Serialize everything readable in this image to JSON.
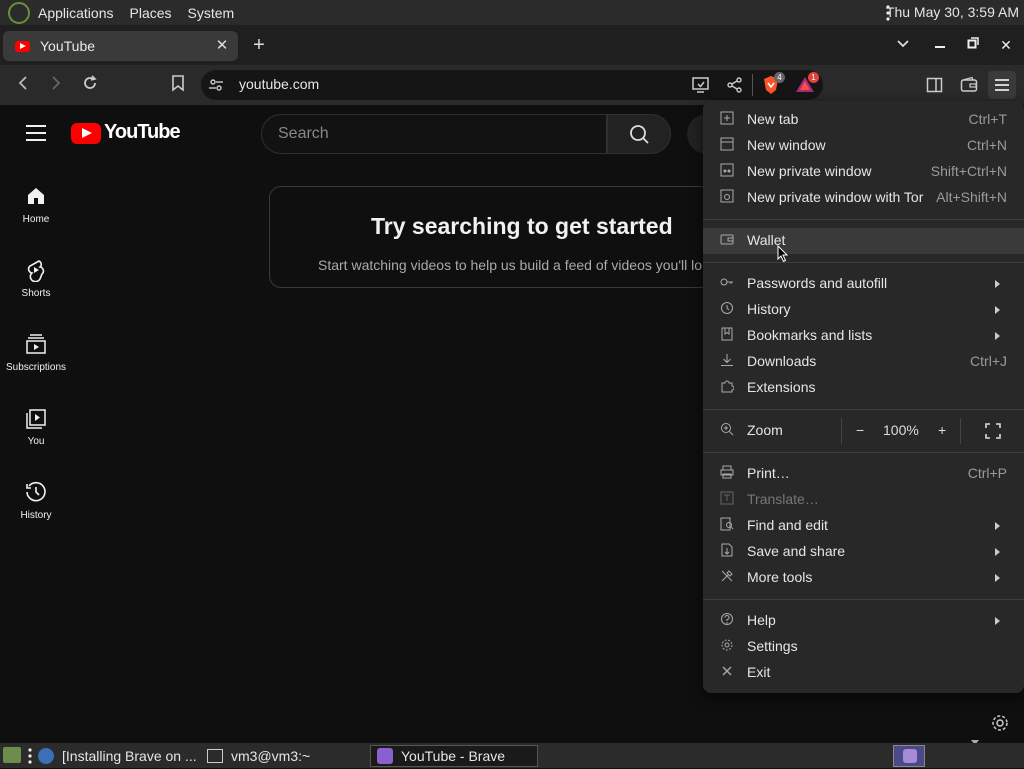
{
  "system_panel": {
    "menus": [
      "Applications",
      "Places",
      "System"
    ],
    "clock": "Thu May 30,  3:59 AM"
  },
  "browser": {
    "tab": {
      "title": "YouTube"
    },
    "url": "youtube.com",
    "shields_badge": "4",
    "rewards_badge": "1"
  },
  "youtube": {
    "logo_text": "YouTube",
    "search_placeholder": "Search",
    "sidebar": [
      {
        "label": "Home",
        "icon": "home-icon"
      },
      {
        "label": "Shorts",
        "icon": "shorts-icon"
      },
      {
        "label": "Subscriptions",
        "icon": "subscriptions-icon"
      },
      {
        "label": "You",
        "icon": "you-icon"
      },
      {
        "label": "History",
        "icon": "history-icon"
      }
    ],
    "feed_title": "Try searching to get started",
    "feed_subtitle": "Start watching videos to help us build a feed of videos you'll lo"
  },
  "menu": {
    "items": [
      {
        "label": "New tab",
        "shortcut": "Ctrl+T",
        "icon": "new-tab-icon"
      },
      {
        "label": "New window",
        "shortcut": "Ctrl+N",
        "icon": "new-window-icon"
      },
      {
        "label": "New private window",
        "shortcut": "Shift+Ctrl+N",
        "icon": "private-window-icon"
      },
      {
        "label": "New private window with Tor",
        "shortcut": "Alt+Shift+N",
        "icon": "tor-window-icon"
      },
      {
        "label": "Wallet",
        "shortcut": "",
        "icon": "wallet-icon"
      },
      {
        "label": "Passwords and autofill",
        "shortcut": "",
        "icon": "key-icon"
      },
      {
        "label": "History",
        "shortcut": "",
        "icon": "history-icon"
      },
      {
        "label": "Bookmarks and lists",
        "shortcut": "",
        "icon": "bookmarks-icon"
      },
      {
        "label": "Downloads",
        "shortcut": "Ctrl+J",
        "icon": "download-icon"
      },
      {
        "label": "Extensions",
        "shortcut": "",
        "icon": "puzzle-icon"
      },
      {
        "label": "Print…",
        "shortcut": "Ctrl+P",
        "icon": "print-icon"
      },
      {
        "label": "Translate…",
        "shortcut": "",
        "icon": "translate-icon"
      },
      {
        "label": "Find and edit",
        "shortcut": "",
        "icon": "find-icon"
      },
      {
        "label": "Save and share",
        "shortcut": "",
        "icon": "save-icon"
      },
      {
        "label": "More tools",
        "shortcut": "",
        "icon": "tools-icon"
      },
      {
        "label": "Help",
        "shortcut": "",
        "icon": "help-icon"
      },
      {
        "label": "Settings",
        "shortcut": "",
        "icon": "gear-icon"
      },
      {
        "label": "Exit",
        "shortcut": "",
        "icon": "exit-icon"
      }
    ],
    "zoom": {
      "label": "Zoom",
      "minus": "−",
      "value": "100%",
      "plus": "+"
    }
  },
  "taskbar": {
    "tasks": [
      "[Installing Brave on ...",
      "vm3@vm3:~",
      "YouTube - Brave"
    ]
  }
}
